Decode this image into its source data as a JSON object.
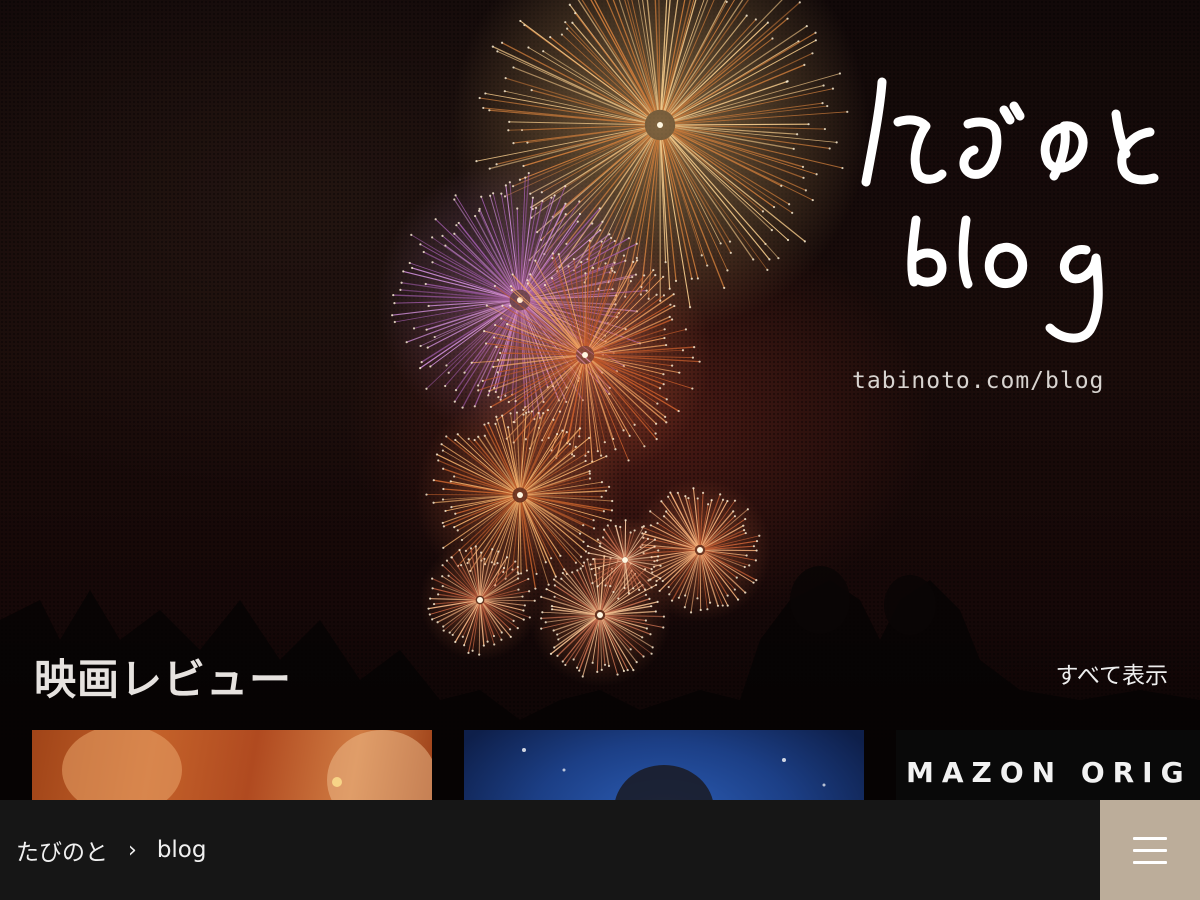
{
  "header": {
    "logo_text": "たびのと blog",
    "site_url": "tabinoto.com/blog"
  },
  "section": {
    "title": "映画レビュー",
    "view_all_label": "すべて表示"
  },
  "cards": [
    {
      "name": "movie-card-1",
      "text": ""
    },
    {
      "name": "movie-card-2",
      "text": ""
    },
    {
      "name": "movie-card-3",
      "text": "MAZON ORIG"
    }
  ],
  "bottom_bar": {
    "breadcrumb": [
      "たびのと",
      "blog"
    ],
    "separator": "›",
    "menu_icon": "hamburger-menu-icon"
  },
  "colors": {
    "bottom_bar_bg": "#161616",
    "menu_button_bg": "#bcad9a"
  }
}
